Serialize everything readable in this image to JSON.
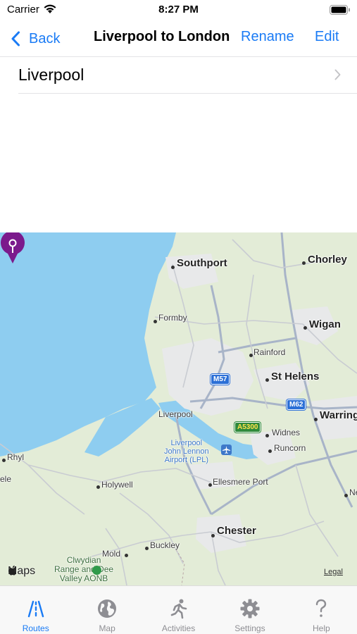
{
  "status_bar": {
    "carrier": "Carrier",
    "time": "8:27 PM"
  },
  "nav": {
    "back_label": "Back",
    "title": "Liverpool to London",
    "rename_label": "Rename",
    "edit_label": "Edit"
  },
  "list": {
    "rows": [
      {
        "label": "Liverpool"
      }
    ]
  },
  "map": {
    "places": {
      "southport": "Southport",
      "chorley": "Chorley",
      "formby": "Formby",
      "wigan": "Wigan",
      "rainford": "Rainford",
      "st_helens": "St Helens",
      "liverpool": "Liverpool",
      "warrington": "Warring",
      "widnes": "Widnes",
      "runcorn": "Runcorn",
      "airport": "Liverpool\nJohn Lennon\nAirport (LPL)",
      "rhyl": "Rhyl",
      "prestatyn_fragment": "ele",
      "holywell": "Holywell",
      "ellesmere_port": "Ellesmere Port",
      "chester": "Chester",
      "mold": "Mold",
      "buckley": "Buckley",
      "clwydian": "Clwydian\nRange and Dee\nValley AONB",
      "ne_fragment": "Ne"
    },
    "road_shields": {
      "m57": "M57",
      "m62": "M62",
      "a5300": "A5300"
    },
    "attribution": "Maps",
    "legal": "Legal",
    "colors": {
      "water": "#8ecdf0",
      "land": "#e3ecd7",
      "urban": "#e9e9ea",
      "pin": "#7b1a8c",
      "motorway": "#a8b4c8",
      "road": "#c9ccd2"
    }
  },
  "tabs": [
    {
      "label": "Routes",
      "icon": "routes-icon",
      "active": true
    },
    {
      "label": "Map",
      "icon": "globe-icon",
      "active": false
    },
    {
      "label": "Activities",
      "icon": "runner-icon",
      "active": false
    },
    {
      "label": "Settings",
      "icon": "gear-icon",
      "active": false
    },
    {
      "label": "Help",
      "icon": "question-icon",
      "active": false
    }
  ],
  "accent_color": "#1a7bf5"
}
